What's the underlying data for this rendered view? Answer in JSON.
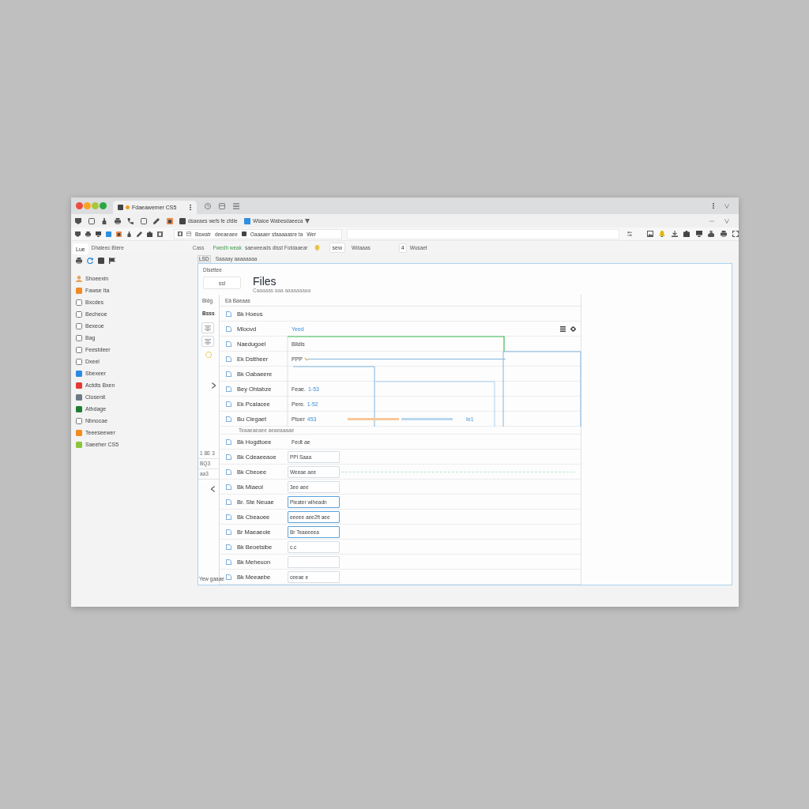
{
  "window": {
    "controls": [
      {
        "color": "#ee4b3e"
      },
      {
        "color": "#f6a623"
      },
      {
        "color": "#a7c73b"
      },
      {
        "color": "#28a745"
      }
    ],
    "tabs": [
      {
        "title": "Fdaeawemer CS5",
        "selected": true
      }
    ]
  },
  "toolbar": {
    "bookmarks": [
      {
        "kind": "folder",
        "label": "dsaeaes wefs fe cfdle",
        "dropdown": false
      },
      {
        "kind": "site",
        "label": "Wtaioe Wabesdaeeca",
        "dropdown": true
      }
    ]
  },
  "address_bar": {
    "links": [
      "Bswatr",
      "deeaeaee",
      "Oaaaaer sfaaaaasre ta",
      "Wer"
    ]
  },
  "nav": {
    "tab": "Lue",
    "title": "Dhaleec Btere",
    "label": "Cass",
    "tag": "Fwedh weak",
    "link": "saeweeads dlsst Fotdaaear",
    "button": "sew",
    "menus": [
      "Wdaaas",
      "Wusaet"
    ],
    "badge": "4"
  },
  "breadcrumb": {
    "code": "LSD",
    "path": "Saaaay aaaaaaaa"
  },
  "sidebar": {
    "items": [
      {
        "kind": "person",
        "label": "Shoeexin"
      },
      {
        "kind": "swatch",
        "label": "Fawse Ita",
        "color": "#f08a24"
      },
      {
        "kind": "checkbox",
        "label": "Bxcdes",
        "checked": false
      },
      {
        "kind": "checkbox",
        "label": "Becheoe",
        "checked": false
      },
      {
        "kind": "checkbox",
        "label": "Bexeoe",
        "checked": false
      },
      {
        "kind": "checkbox",
        "label": "Bag",
        "checked": false
      },
      {
        "kind": "checkbox",
        "label": "Feestdeer",
        "checked": false
      },
      {
        "kind": "checkbox",
        "label": "Dxeel",
        "checked": false
      },
      {
        "kind": "swatch",
        "label": "Sbexeer",
        "color": "#2b8be0"
      },
      {
        "kind": "swatch",
        "label": "Actdts Bxen",
        "color": "#e53935"
      },
      {
        "kind": "swatch",
        "label": "Closenit",
        "color": "#6c7a89"
      },
      {
        "kind": "swatch",
        "label": "Athdage",
        "color": "#1e7d32"
      },
      {
        "kind": "checkbox",
        "label": "Nbnocae",
        "checked": false
      },
      {
        "kind": "swatch",
        "label": "Teeeseewer",
        "color": "#f28c1e"
      },
      {
        "kind": "swatch",
        "label": "Saeeher CS5",
        "color": "#8cc43c"
      }
    ]
  },
  "panel": {
    "caption": "Dlsettee",
    "button": "ssl",
    "title": "Files",
    "subtitle": "Caaaaas aaa aaaaaaaaa",
    "rail": {
      "labels": [
        "Bldg",
        "Bsss"
      ],
      "notes": [
        "1 8E 3",
        "BQ3",
        "aa3"
      ],
      "footer": "Yew gaaae"
    },
    "table": {
      "header": "Eä Baeaas",
      "rows": [
        {
          "name": "Bk Hoeus",
          "actions": false
        },
        {
          "name": "Mloovd",
          "link": "Yeed",
          "actions": true
        },
        {
          "name": "Naedugoel",
          "value": "Blldis",
          "actions": false
        },
        {
          "name": "Ek Dsttheer",
          "value": "PPP",
          "actions": false
        },
        {
          "name": "Bk Oabaeere",
          "actions": false
        },
        {
          "name": "Bey Ohtabze",
          "value": "Feae.",
          "link": "1-53",
          "actions": false
        },
        {
          "name": "Ek Pcalacee",
          "value": "Pere.",
          "link": "1-52",
          "actions": false
        },
        {
          "name": "Bu Clegaet",
          "value": "Ptoer",
          "link": "453",
          "note": "te1",
          "actions": false
        }
      ],
      "section": "Teaaeaeaee aeaeaaaae",
      "fields": [
        {
          "kind": "text",
          "name": "Bk Hogdtoee",
          "value": "Fedt ae"
        },
        {
          "kind": "input",
          "name": "Bk Cdeaeeaoe",
          "value": "PPl Saaa",
          "highlighted": false
        },
        {
          "kind": "input",
          "name": "Bk Cbeoee",
          "value": "Weeae aee",
          "highlighted": false
        },
        {
          "kind": "input",
          "name": "Bk Miaeol",
          "value": "3ee aee",
          "highlighted": false
        },
        {
          "kind": "input",
          "name": "Br. Ste Neuae",
          "value": "Pieater wlheadn",
          "highlighted": true
        },
        {
          "kind": "input",
          "name": "Bk Cbeaoee",
          "value": "eeeee aee2ft aee",
          "highlighted": true
        },
        {
          "kind": "input",
          "name": "Br Maeaeole",
          "value": "Br Teaeeeea",
          "highlighted": true
        },
        {
          "kind": "input",
          "name": "Bk Beoetsibe",
          "value": "c.c",
          "highlighted": false
        },
        {
          "kind": "input",
          "name": "Bk Meheuon",
          "highlighted": false
        },
        {
          "kind": "input",
          "name": "Bk Meeaebe",
          "value": "ceeae e",
          "highlighted": false
        }
      ]
    }
  }
}
